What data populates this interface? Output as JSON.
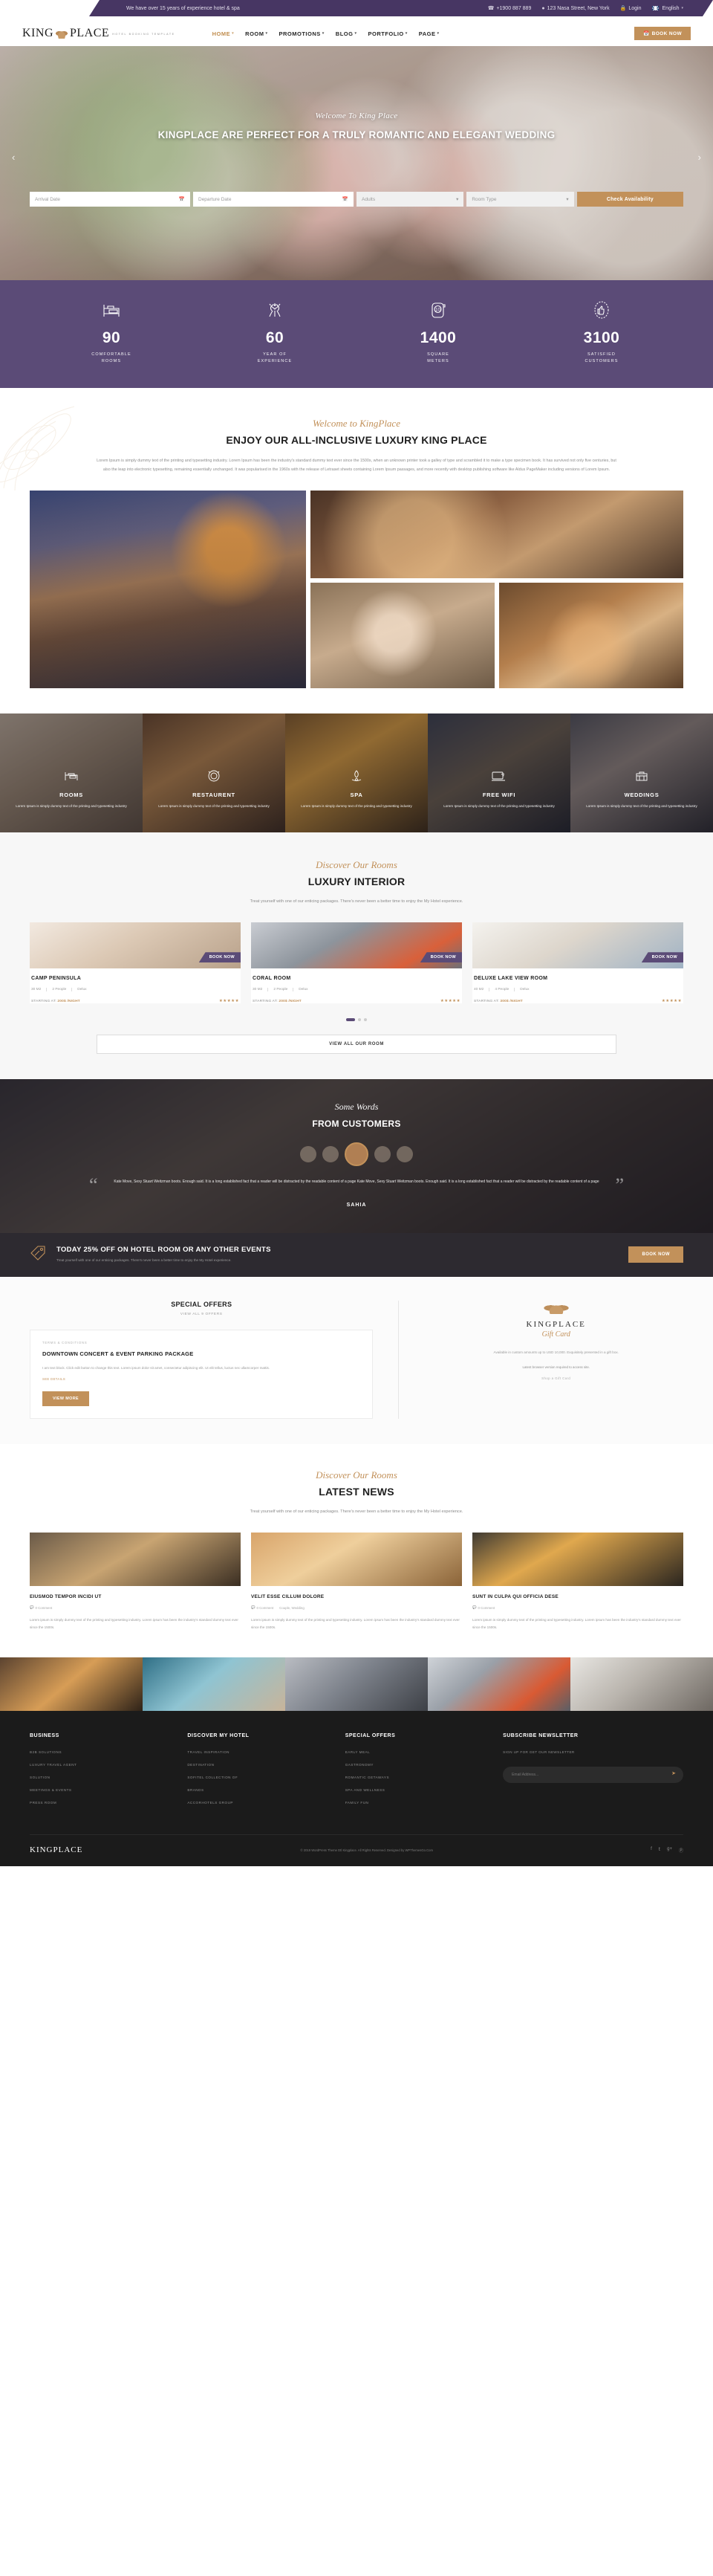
{
  "topbar": {
    "tagline": "We have over 15 years of experience hotel & spa",
    "phone": "+1900 887 889",
    "address": "123 Nasa Street, New York",
    "login": "Login",
    "language": "English"
  },
  "brand": {
    "name_left": "KING",
    "name_right": "PLACE",
    "sub": "HOTEL BOOKING TEMPLATE",
    "footer_name": "KINGPLACE"
  },
  "nav": {
    "items": [
      {
        "label": "HOME",
        "active": true
      },
      {
        "label": "ROOM",
        "active": false
      },
      {
        "label": "PROMOTIONS",
        "active": false
      },
      {
        "label": "BLOG",
        "active": false
      },
      {
        "label": "PORTFOLIO",
        "active": false
      },
      {
        "label": "PAGE",
        "active": false
      }
    ],
    "book_now": "BOOK NOW"
  },
  "hero": {
    "script": "Welcome To King Place",
    "title": "KINGPLACE ARE PERFECT FOR A TRULY ROMANTIC AND ELEGANT WEDDING",
    "prev": "‹",
    "next": "›"
  },
  "booking": {
    "arrival_placeholder": "Arrival Date",
    "departure_placeholder": "Departure Date",
    "adults": "Adults",
    "room_type": "Room Type",
    "submit": "Check Availability"
  },
  "stats": [
    {
      "icon": "bed-icon",
      "value": "90",
      "label": "COMFORTABLE\nROOMS"
    },
    {
      "icon": "fireworks-icon",
      "value": "60",
      "label": "YEAR OF\nEXPERIENCE"
    },
    {
      "icon": "area-icon",
      "value": "1400",
      "label": "SQUARE\nMETERS"
    },
    {
      "icon": "thumbs-up-icon",
      "value": "3100",
      "label": "SATISFIED\nCUSTOMERS"
    }
  ],
  "welcome": {
    "script": "Welcome to KingPlace",
    "title": "ENJOY OUR ALL-INCLUSIVE LUXURY KING PLACE",
    "body": "Lorem Ipsum is simply dummy text of the printing and typesetting industry. Lorem Ipsum has been the industry's standard dummy text ever since the 1500s, when an unknown printer took a galley of type and scrambled it to make a type specimen book. It has survived not only five centuries, but also the leap into electronic typesetting, remaining essentially unchanged. It was popularised in the 1960s with the release of Letraset sheets containing Lorem Ipsum passages, and more recently with desktop publishing software like Aldus PageMaker including versions of Lorem Ipsum."
  },
  "services": [
    {
      "icon": "bed-service-icon",
      "name": "ROOMS",
      "text": "Lorem Ipsum is simply dummy text of the printing and typesetting industry"
    },
    {
      "icon": "dinner-icon",
      "name": "RESTAURENT",
      "text": "Lorem Ipsum is simply dummy text of the printing and typesetting industry"
    },
    {
      "icon": "spa-icon",
      "name": "SPA",
      "text": "Lorem Ipsum is simply dummy text of the printing and typesetting industry"
    },
    {
      "icon": "wifi-icon",
      "name": "FREE WIFI",
      "text": "Lorem Ipsum is simply dummy text of the printing and typesetting industry"
    },
    {
      "icon": "wedding-icon",
      "name": "WEDDINGS",
      "text": "Lorem Ipsum is simply dummy text of the printing and typesetting industry"
    }
  ],
  "rooms_section": {
    "script": "Discover Our Rooms",
    "title": "LUXURY INTERIOR",
    "subtitle": "Treat yourself with one of our enticing packages. There's never been a better time to enjoy the My Hotel experience.",
    "book_now": "BOOK NOW",
    "price_prefix": "STARTING AT:",
    "view_all": "VIEW ALL OUR ROOM",
    "cards": [
      {
        "name": "CAMP PENINSULA",
        "size": "30 M2",
        "people": "2 People",
        "type": "Delux",
        "price": "200$ /NIGHT",
        "stars": "★★★★★"
      },
      {
        "name": "CORAL ROOM",
        "size": "30 M2",
        "people": "2 People",
        "type": "Delux",
        "price": "200$ /NIGHT",
        "stars": "★★★★★"
      },
      {
        "name": "DELUXE LAKE VIEW ROOM",
        "size": "40 M2",
        "people": "4 People",
        "type": "Delux",
        "price": "300$ /NIGHT",
        "stars": "★★★★★"
      }
    ]
  },
  "testimonial": {
    "script": "Some Words",
    "title": "FROM CUSTOMERS",
    "quote": "Kate Move, Sexy Stuart Weitzman boots. Enough said. It is a long established fact that a reader will be distracted by the readable content of a page Kate Move, Sexy Stuart Weitzman boots. Enough said. It is a long established fact that a reader will be distracted by the readable content of a page",
    "name": "SAHIA"
  },
  "promo": {
    "icon": "discount-icon",
    "heading": "TODAY 25% OFF ON HOTEL ROOM OR ANY OTHER EVENTS",
    "text": "Treat yourself with one of our enticing packages. There's never been a better time to enjoy the My Hotel experience.",
    "button": "BOOK NOW"
  },
  "offers": {
    "heading": "SPECIAL OFFERS",
    "view_all": "VIEW ALL 9 OFFERS",
    "eyebrow": "TERMS & CONDITIONS",
    "title": "DOWNTOWN CONCERT & EVENT PARKING PACKAGE",
    "body": "I am text block. Click edit button to change this text. Lorem ipsum dolor sit amet, consectetur adipiscing elit. Ut elit tellus, luctus nec ullamcorper mattis.",
    "more": "SEE DETAILS",
    "button": "VIEW MORE"
  },
  "gift": {
    "brand": "KINGPLACE",
    "script": "Gift Card",
    "body": "Available in custom amounts up to USD 10,000. Exquisitely presented in a gift box.",
    "note": "Latest browser version required to access site.",
    "link": "Shop a Gift Card"
  },
  "news": {
    "script": "Discover Our Rooms",
    "title": "LATEST NEWS",
    "subtitle": "Treat yourself with one of our enticing packages. There's never been a better time to enjoy the My Hotel experience.",
    "cards": [
      {
        "title": "EIUSMOD TEMPOR INCIDI UT",
        "comments": "0 Comment",
        "tags": "",
        "body": "Lorem ipsum is simply dummy text of the printing and typesetting industry. Lorem ipsum has been the industry's standard dummy text ever since the 1500s."
      },
      {
        "title": "VELIT ESSE CILLUM DOLORE",
        "comments": "0 Comment",
        "tags": "Couple, Wedding",
        "body": "Lorem ipsum is simply dummy text of the printing and typesetting industry. Lorem ipsum has been the industry's standard dummy text ever since the 1500s."
      },
      {
        "title": "SUNT IN CULPA QUI OFFICIA DESE",
        "comments": "0 Comment",
        "tags": "",
        "body": "Lorem ipsum is simply dummy text of the printing and typesetting industry. Lorem ipsum has been the industry's standard dummy text ever since the 1500s."
      }
    ]
  },
  "footer": {
    "columns": [
      {
        "heading": "BUSINESS",
        "links": [
          "B2B SOLUTIONS",
          "LUXURY TRAVEL AGENT",
          "SOLUTION",
          "MEETINGS & EVENTS",
          "PRESS ROOM"
        ]
      },
      {
        "heading": "DISCOVER MY HOTEL",
        "links": [
          "TRAVEL INSPIRATION",
          "DESTINATION",
          "SOFITEL COLLECTION OF",
          "BRANDS",
          "ACCORHOTELS GROUP"
        ]
      },
      {
        "heading": "SPECIAL OFFERS",
        "links": [
          "EARLY MEAL",
          "GASTRONOMY",
          "ROMANTIC GETAWAYS",
          "SPA AND WELLNESS",
          "FAMILY FUN"
        ]
      }
    ],
    "newsletter": {
      "heading": "SUBSCRIBE NEWSLETTER",
      "sub": "SIGN UP FOR GET OUR NEWSLETTER",
      "placeholder": "Email Address...",
      "send_icon": "send-icon"
    },
    "copyright": "© 2019 WordPress Theme Dtl Kingplace. All Rights Reserved. Designed by WPThemesGo.Com",
    "social": [
      "facebook-icon",
      "twitter-icon",
      "google-plus-icon",
      "pinterest-icon"
    ]
  },
  "colors": {
    "accent_gold": "#c2915a",
    "purple": "#5b4b77",
    "topbar_purple": "#473663",
    "dark": "#1b1b1b"
  }
}
